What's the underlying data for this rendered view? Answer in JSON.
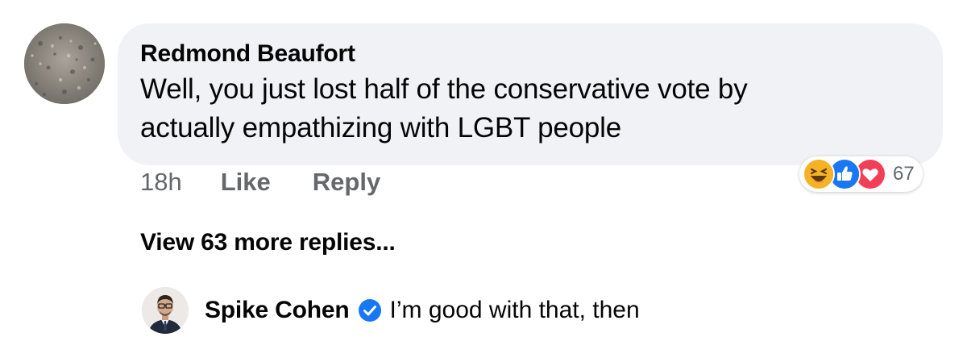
{
  "comment": {
    "author": "Redmond Beaufort",
    "text_line1": "Well, you just lost half of the conservative vote by",
    "text_line2": "actually empathizing with LGBT people",
    "time": "18h",
    "like_label": "Like",
    "reply_label": "Reply",
    "reaction_count": "67",
    "reactions": [
      "haha-icon",
      "like-icon",
      "love-icon"
    ]
  },
  "view_more": "View 63 more replies...",
  "reply": {
    "author": "Spike Cohen",
    "verified": true,
    "text": "I’m good with that, then"
  },
  "colors": {
    "bubble": "#f0f2f5",
    "secondary_text": "#65676b",
    "like_blue": "#1877f2",
    "love_red": "#f33e58",
    "haha_yellow": "#f7b125"
  }
}
